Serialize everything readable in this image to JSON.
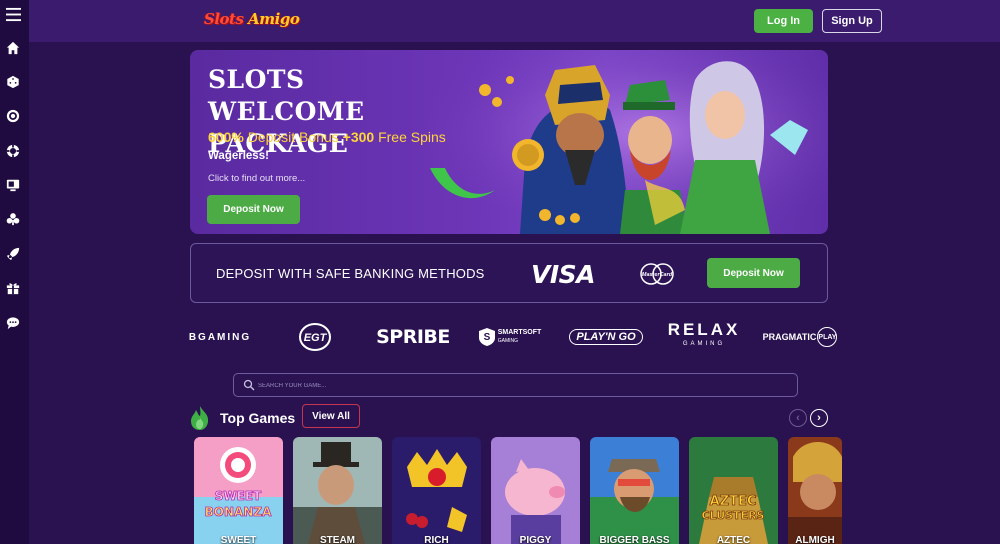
{
  "header": {
    "logo_text_1": "Slots",
    "logo_text_2": "Amigo",
    "login_label": "Log In",
    "signup_label": "Sign Up"
  },
  "sidebar": {
    "items": [
      {
        "icon": "menu-icon"
      },
      {
        "icon": "home-icon"
      },
      {
        "icon": "dice-icon"
      },
      {
        "icon": "roulette-icon"
      },
      {
        "icon": "poker-chip-icon"
      },
      {
        "icon": "live-casino-icon"
      },
      {
        "icon": "cards-icon"
      },
      {
        "icon": "rocket-icon"
      },
      {
        "icon": "gift-icon"
      },
      {
        "icon": "chat-icon"
      }
    ]
  },
  "hero": {
    "title": "SLOTS WELCOME PACKAGE",
    "bonus_part1": "600%",
    "bonus_part2": " Deposit Bonus ",
    "bonus_part3": "+300",
    "bonus_part4": " Free Spins",
    "wagerless": "Wagerless!",
    "click_text": "Click to find out more...",
    "button_label": "Deposit Now"
  },
  "deposit_panel": {
    "text": "DEPOSIT WITH SAFE BANKING METHODS",
    "visa": "VISA",
    "mastercard": "MasterCard",
    "button_label": "Deposit Now"
  },
  "providers": {
    "bgaming": "BGAMING",
    "egt": "EGT",
    "spribe": "SPRIBE",
    "smartsoft_1": "SMARTSOFT",
    "smartsoft_2": "GAMING",
    "playngo": "PLAY'N GO",
    "relax_1": "RELAX",
    "relax_2": "GAMING",
    "pragmatic_1": "PRAGMATIC",
    "pragmatic_2": "PLAY"
  },
  "search": {
    "placeholder": "SEARCH YOUR GAME..."
  },
  "top_games": {
    "title": "Top Games",
    "view_all": "View All",
    "prev": "‹",
    "next": "›",
    "games": [
      {
        "name": "SWEET",
        "art_text": "SWEET BONANZA"
      },
      {
        "name": "STEAM"
      },
      {
        "name": "RICH"
      },
      {
        "name": "PIGGY"
      },
      {
        "name": "BIGGER BASS"
      },
      {
        "name": "AZTEC",
        "art_text": "AZTEC CLUSTERS"
      },
      {
        "name": "ALMIGH"
      }
    ]
  },
  "colors": {
    "background": "#2a1251",
    "header": "#3a1b6e",
    "sidebar": "#1f0b40",
    "accent_green": "#4cab44",
    "bonus_yellow": "#ffd43a"
  }
}
